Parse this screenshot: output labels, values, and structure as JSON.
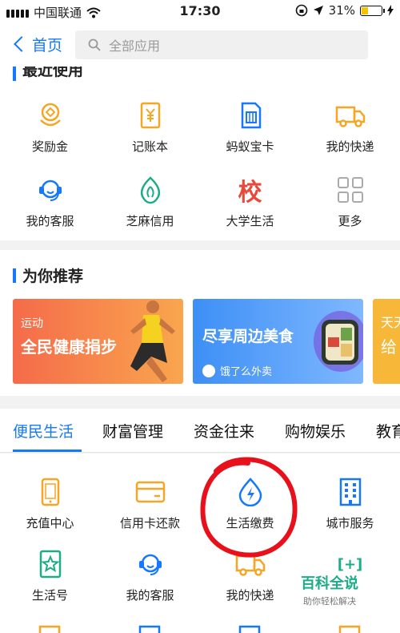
{
  "status_bar": {
    "carrier": "中国联通",
    "time": "17:30",
    "battery": "31%",
    "battery_level": 0.31
  },
  "nav": {
    "back_label": "首页",
    "search_placeholder": "全部应用"
  },
  "recent": {
    "title": "最近使用",
    "items": [
      {
        "label": "奖励金",
        "icon": "reward-icon"
      },
      {
        "label": "记账本",
        "icon": "ledger-icon"
      },
      {
        "label": "蚂蚁宝卡",
        "icon": "sim-card-icon"
      },
      {
        "label": "我的快递",
        "icon": "truck-icon"
      },
      {
        "label": "我的客服",
        "icon": "headset-icon"
      },
      {
        "label": "芝麻信用",
        "icon": "sesame-icon"
      },
      {
        "label": "大学生活",
        "icon": "school-icon",
        "glyph": "校"
      },
      {
        "label": "更多",
        "icon": "more-grid-icon"
      }
    ]
  },
  "recommend": {
    "title": "为你推荐",
    "banners": [
      {
        "tag": "运动",
        "title": "全民健康捐步"
      },
      {
        "title": "尽享周边美食",
        "sub": "饿了么外卖"
      },
      {
        "title": "天天",
        "sub": "给"
      }
    ]
  },
  "tabs": [
    "便民生活",
    "财富管理",
    "资金往来",
    "购物娱乐",
    "教育"
  ],
  "life_services": {
    "items": [
      {
        "label": "充值中心",
        "icon": "phone-recharge-icon"
      },
      {
        "label": "信用卡还款",
        "icon": "credit-card-icon"
      },
      {
        "label": "生活缴费",
        "icon": "utility-payment-icon"
      },
      {
        "label": "城市服务",
        "icon": "city-building-icon"
      },
      {
        "label": "生活号",
        "icon": "life-account-icon"
      },
      {
        "label": "我的客服",
        "icon": "headset-icon"
      },
      {
        "label": "我的快递",
        "icon": "truck-icon"
      },
      {
        "label": "",
        "icon": "add-icon",
        "glyph": "[+]"
      }
    ]
  },
  "watermark": {
    "title": "百科全说",
    "subtitle": "助你轻松解决"
  },
  "colors": {
    "accent": "#1677ff",
    "orange_icon": "#f5a623",
    "annotation_circle": "#e8101a"
  }
}
